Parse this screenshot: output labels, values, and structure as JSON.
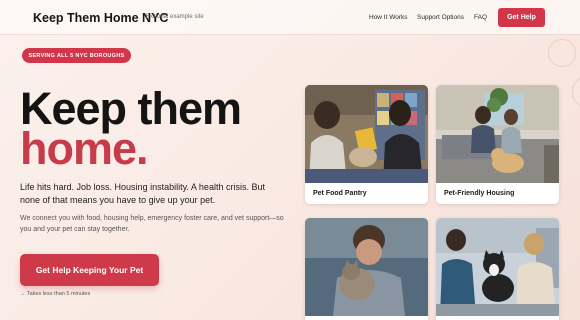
{
  "header": {
    "brand": "Keep Them Home NYC",
    "tagline": "Fictional example site",
    "nav": [
      {
        "label": "How It Works"
      },
      {
        "label": "Support Options"
      },
      {
        "label": "FAQ"
      }
    ],
    "cta_label": "Get Help"
  },
  "hero": {
    "badge": "SERVING ALL 5 NYC BOROUGHS",
    "headline_line1": "Keep them",
    "headline_line2": "home.",
    "lead": "Life hits hard. Job loss. Housing instability. A health crisis. But none of that means you have to give up your pet.",
    "sub": "We connect you with food, housing help, emergency foster care, and vet support—so you and your pet can stay together.",
    "cta_label": "Get Help Keeping Your Pet",
    "note": "→ Takes less than 5 minutes"
  },
  "cards": [
    {
      "caption": "Pet Food Pantry"
    },
    {
      "caption": "Pet-Friendly Housing"
    },
    {
      "caption": ""
    },
    {
      "caption": ""
    }
  ],
  "colors": {
    "accent": "#d2364a",
    "headline_accent": "#c63c4b",
    "background": "#fbf1ec"
  }
}
